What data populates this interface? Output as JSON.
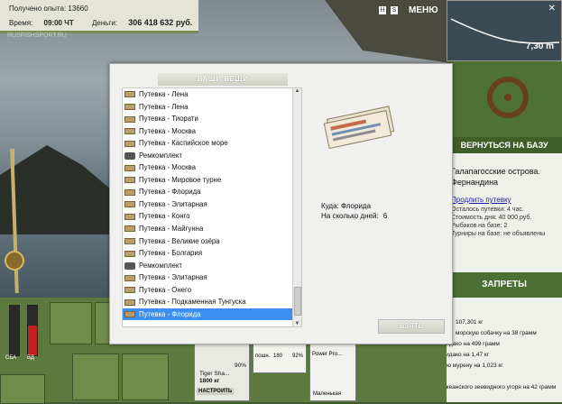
{
  "hud": {
    "exp_label": "Получено опыта:",
    "exp_value": "13660",
    "time_label": "Время:",
    "time_value": "09:00 ЧТ",
    "money_label": "Деньги:",
    "money_value": "306 418 632 руб.",
    "site": "RUSFISHSPORT.RU",
    "menu_label": "МЕНЮ",
    "icon_h": "H",
    "icon_s": "S"
  },
  "depth": {
    "value": "7,30 m",
    "close": "✕"
  },
  "right_panel": {
    "return_label": "ВЕРНУТЬСЯ НА БАЗУ",
    "location_line1": "Галапагосские острова.",
    "location_line2": "Фернандина",
    "prolong_link": "Продлить путевку",
    "info_lines": [
      "Осталось путевки: 4 час.",
      "Стоимость дня: 40 000 руб.",
      "Рыбаков на базе: 2",
      "Турниры на базе: не объявлены"
    ],
    "bans_label": "ЗАПРЕТЫ",
    "feed": [
      "107,301 кг",
      "морскую собачку на 38 грамм",
      "Петр поймал Мурену Кидако на 499 грамм",
      "Nilka поймал Мурену Кидако на 1,47 кг",
      "Леонид поймал Пёструю мурену на 1,023 кг",
      "Роман упустил рыбу",
      "Antohin1 поймал Тихоокеанского зеевидного угоря на 42 грамм"
    ]
  },
  "dialog": {
    "title": "ВАШИ ВЕЩИ",
    "items": [
      {
        "label": "Путевка - Лена",
        "type": "ticket"
      },
      {
        "label": "Путевка - Лена",
        "type": "ticket"
      },
      {
        "label": "Путевка - Тиорати",
        "type": "ticket"
      },
      {
        "label": "Путевка - Москва",
        "type": "ticket"
      },
      {
        "label": "Путевка - Каспийское море",
        "type": "ticket"
      },
      {
        "label": "Ремкомплект",
        "type": "kit"
      },
      {
        "label": "Путевка - Москва",
        "type": "ticket"
      },
      {
        "label": "Путевка - Мировое турне",
        "type": "ticket"
      },
      {
        "label": "Путевка - Флорида",
        "type": "ticket"
      },
      {
        "label": "Путевка - Элитарная",
        "type": "ticket"
      },
      {
        "label": "Путевка - Конго",
        "type": "ticket"
      },
      {
        "label": "Путевка - Майгунна",
        "type": "ticket"
      },
      {
        "label": "Путевка - Великие озёра",
        "type": "ticket"
      },
      {
        "label": "Путевка - Болгария",
        "type": "ticket"
      },
      {
        "label": "Ремкомплект",
        "type": "kit"
      },
      {
        "label": "Путевка - Элитарная",
        "type": "ticket"
      },
      {
        "label": "Путевка - Онего",
        "type": "ticket"
      },
      {
        "label": "Путевка - Подкаменная Тунгуска",
        "type": "ticket"
      },
      {
        "label": "Путевка - Флорида",
        "type": "ticket",
        "selected": true
      }
    ],
    "detail_where_label": "Куда:",
    "detail_where_value": "Флорида",
    "detail_days_label": "На сколько дней:",
    "detail_days_value": "6",
    "take_label": "ВЗЯТЬ"
  },
  "bottom": {
    "meter_left_label": "СБА",
    "meter_right_label": "ВД",
    "tackle1_name": "Tiger Sha...",
    "tackle1_weight": "1800 кг",
    "tackle1_pct": "90%",
    "tackle2_left": "пошн.",
    "tackle2_mid": "180",
    "tackle2_pct": "92%",
    "tackle3_name": "Power Pro...",
    "tackle3_caption": "Маленькая",
    "setup_label": "НАСТРОИТЬ"
  }
}
